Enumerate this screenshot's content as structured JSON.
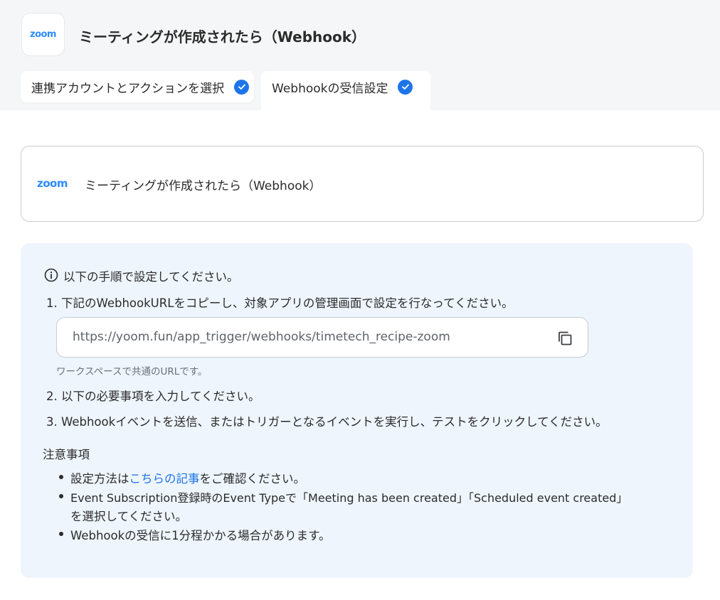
{
  "header": {
    "app_logo_text": "zoom",
    "title": "ミーティングが作成されたら（Webhook）"
  },
  "tabs": [
    {
      "label": "連携アカウントとアクションを選択",
      "completed": true
    },
    {
      "label": "Webhookの受信設定",
      "completed": true,
      "active": true
    }
  ],
  "trigger": {
    "logo_text": "zoom",
    "label": "ミーティングが作成されたら（Webhook）"
  },
  "instructions": {
    "intro": "以下の手順で設定してください。",
    "steps": [
      "1. 下記のWebhookURLをコピーし、対象アプリの管理画面で設定を行なってください。",
      "2. 以下の必要事項を入力してください。",
      "3. Webhookイベントを送信、またはトリガーとなるイベントを実行し、テストをクリックしてください。"
    ],
    "webhook_url": "https://yoom.fun/app_trigger/webhooks/timetech_recipe-zoom",
    "url_hint": "ワークスペースで共通のURLです。",
    "notes_heading": "注意事項",
    "notes": {
      "note1_prefix": "設定方法は",
      "note1_link": "こちらの記事",
      "note1_suffix": "をご確認ください。",
      "note2_line1": "Event Subscription登録時のEvent Typeで「Meeting has been created」「Scheduled event created」",
      "note2_line2": "を選択してください。",
      "note3": "Webhookの受信に1分程かかる場合があります。"
    }
  },
  "colors": {
    "accent": "#1d74e8",
    "zoom_brand": "#2d8cff",
    "info_panel_bg": "#eef5fc",
    "header_bg": "#f5f6f7"
  }
}
